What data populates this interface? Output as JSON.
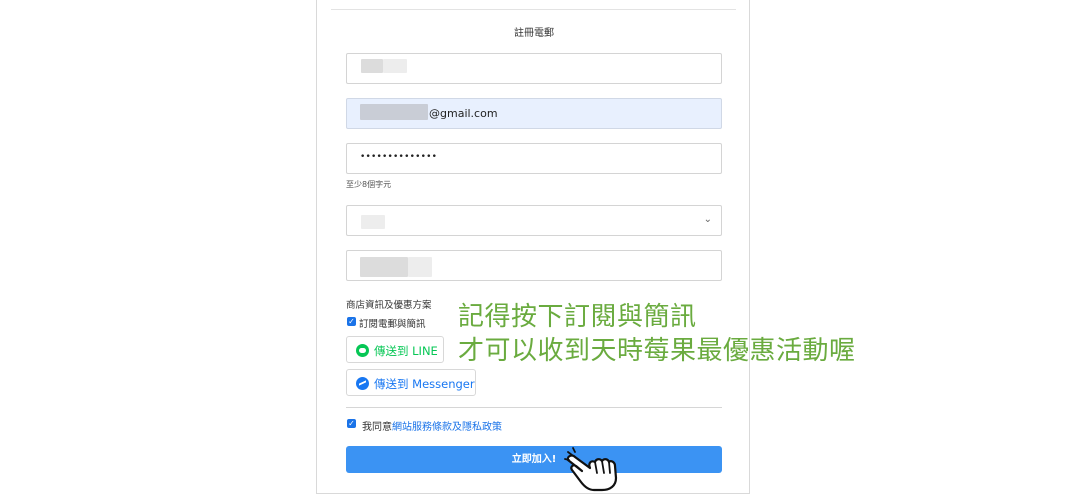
{
  "section_title": "註冊電郵",
  "email_field": {
    "suffix": "@gmail.com"
  },
  "password_field": {
    "value": "••••••••••••••",
    "hint": "至少8個字元"
  },
  "select_field": {
    "chevron": "⌄",
    "icon": "chevron-down-icon"
  },
  "subscription": {
    "heading": "商店資訊及優惠方案",
    "checkbox_label": "訂閱電郵與簡訊",
    "checked": true,
    "line_button": "傳送到 LINE",
    "messenger_button": "傳送到 Messenger"
  },
  "agreement": {
    "prefix": "我同意",
    "link_text": "網站服務條款及隱私政策",
    "checked": true
  },
  "submit_label": "立即加入!",
  "promo": {
    "line1": "記得按下訂閱與簡訊",
    "line2": "才可以收到天時莓果最優惠活動喔"
  },
  "colors": {
    "accent": "#3b93f3",
    "promo_green": "#6aab3f",
    "line_green": "#06c755",
    "messenger_blue": "#1877f2",
    "autofill_bg": "#e8f0fe"
  }
}
